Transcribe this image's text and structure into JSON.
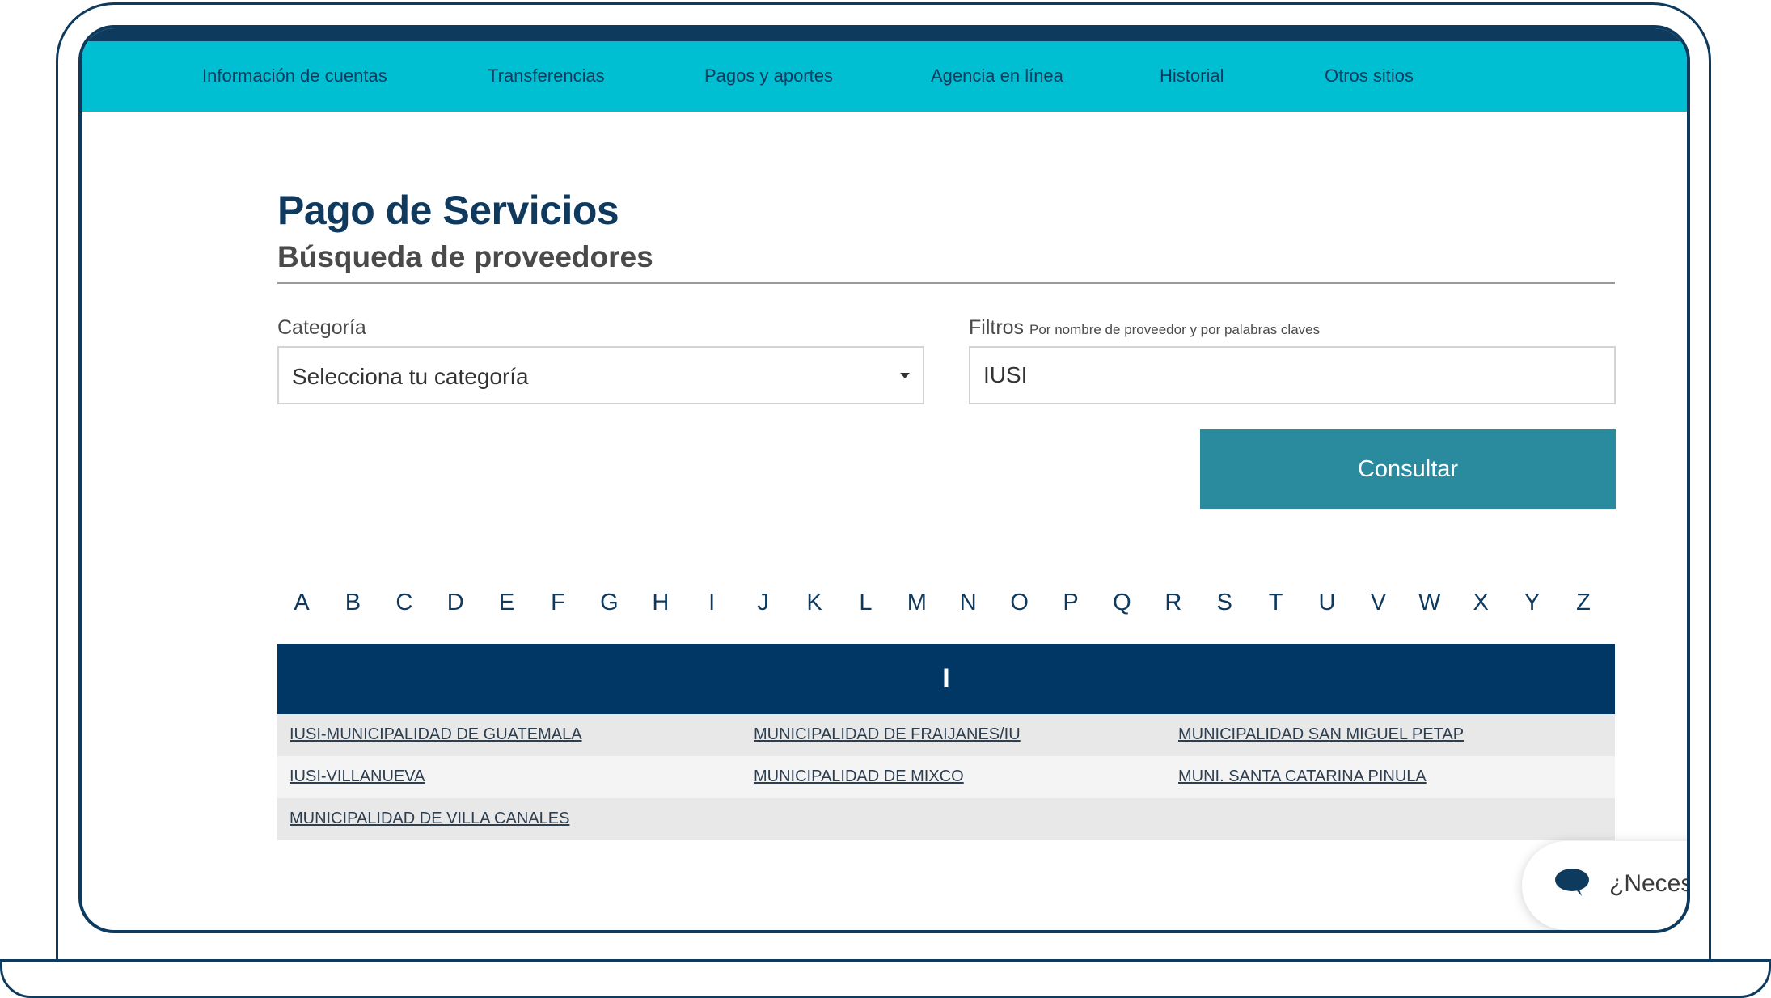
{
  "nav": {
    "items": [
      {
        "label": "Información de cuentas"
      },
      {
        "label": "Transferencias"
      },
      {
        "label": "Pagos y aportes"
      },
      {
        "label": "Agencia en línea"
      },
      {
        "label": "Historial"
      },
      {
        "label": "Otros sitios"
      }
    ]
  },
  "page": {
    "title": "Pago de Servicios",
    "subtitle": "Búsqueda de proveedores"
  },
  "form": {
    "category_label": "Categoría",
    "category_value": "Selecciona tu categoría",
    "filter_label": "Filtros",
    "filter_hint": "Por nombre de proveedor y por palabras claves",
    "filter_value": "IUSI",
    "submit_label": "Consultar"
  },
  "alphabet": [
    "A",
    "B",
    "C",
    "D",
    "E",
    "F",
    "G",
    "H",
    "I",
    "J",
    "K",
    "L",
    "M",
    "N",
    "O",
    "P",
    "Q",
    "R",
    "S",
    "T",
    "U",
    "V",
    "W",
    "X",
    "Y",
    "Z"
  ],
  "results": {
    "header_letter": "I",
    "rows": [
      [
        "IUSI-MUNICIPALIDAD DE GUATEMALA",
        "MUNICIPALIDAD DE FRAIJANES/IU",
        "MUNICIPALIDAD SAN MIGUEL PETAP"
      ],
      [
        "IUSI-VILLANUEVA",
        "MUNICIPALIDAD DE MIXCO",
        "MUNI. SANTA CATARINA PINULA"
      ],
      [
        "MUNICIPALIDAD DE VILLA CANALES",
        "",
        ""
      ]
    ]
  },
  "chat": {
    "label": "¿Neces"
  },
  "colors": {
    "navbar": "#00bfd2",
    "header_dark": "#003764",
    "button": "#2a8a9e",
    "title": "#0f3a5e"
  }
}
